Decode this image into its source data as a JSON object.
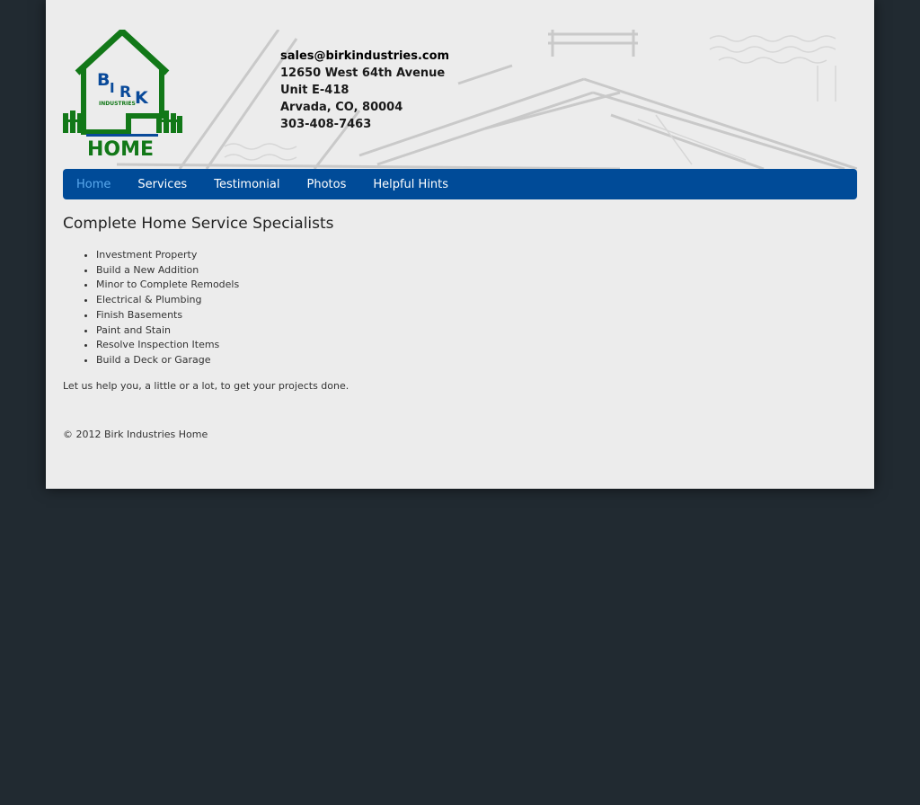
{
  "logo": {
    "text_top": [
      "B",
      "I",
      "R",
      "K"
    ],
    "text_small": "INDUSTRIES",
    "text_bottom": "HOME",
    "colors": {
      "green": "#127818",
      "blue": "#0a4a9a"
    }
  },
  "contact": {
    "email": "sales@birkindustries.com",
    "street": "12650 West 64th Avenue",
    "unit": "Unit E-418",
    "city": "Arvada, CO, 80004",
    "phone": "303-408-7463"
  },
  "nav": {
    "items": [
      {
        "label": "Home",
        "active": true
      },
      {
        "label": "Services",
        "active": false
      },
      {
        "label": "Testimonial",
        "active": false
      },
      {
        "label": "Photos",
        "active": false
      },
      {
        "label": "Helpful Hints",
        "active": false
      }
    ],
    "colors": {
      "bar": "#004b98",
      "text": "#ffffff",
      "active_text": "#5aa9ee"
    }
  },
  "main": {
    "heading": "Complete Home Service Specialists",
    "services": [
      "Investment Property",
      "Build a New Addition",
      "Minor to Complete Remodels",
      "Electrical & Plumbing",
      "Finish Basements",
      "Paint and Stain",
      "Resolve Inspection Items",
      "Build a Deck or Garage"
    ],
    "help_text": "Let us help you, a little or a lot, to get your projects done."
  },
  "footer": {
    "copyright": "© 2012 Birk Industries Home"
  },
  "colors": {
    "background": "#212a31",
    "page": "#ececec"
  }
}
